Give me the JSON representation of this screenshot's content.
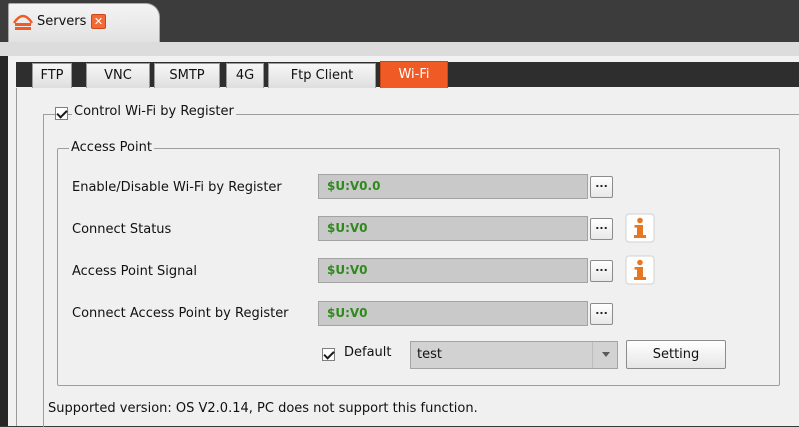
{
  "doc_tab": {
    "title": "Servers",
    "close_glyph": "✕",
    "icon": "server-icon"
  },
  "tabs": [
    {
      "label": "FTP",
      "active": false
    },
    {
      "label": "VNC",
      "active": false
    },
    {
      "label": "SMTP",
      "active": false
    },
    {
      "label": "4G",
      "active": false
    },
    {
      "label": "Ftp Client",
      "active": false
    },
    {
      "label": "Wi-Fi",
      "active": true
    }
  ],
  "wifi": {
    "control_checkbox": {
      "label": "Control Wi-Fi by Register",
      "checked": true
    },
    "access_point": {
      "title": "Access Point",
      "rows": [
        {
          "label": "Enable/Disable Wi-Fi by Register",
          "value": "$U:V0.0",
          "browse_label": "...",
          "info": false
        },
        {
          "label": "Connect Status",
          "value": "$U:V0",
          "browse_label": "...",
          "info": true
        },
        {
          "label": "Access Point Signal",
          "value": "$U:V0",
          "browse_label": "...",
          "info": true
        },
        {
          "label": "Connect Access Point by Register",
          "value": "$U:V0",
          "browse_label": "...",
          "info": false
        }
      ],
      "default_checkbox": {
        "label": "Default",
        "checked": true
      },
      "ssid_combo": {
        "value": "test"
      },
      "setting_button": "Setting"
    },
    "note": "Supported version: OS V2.0.14, PC does not support this function."
  },
  "colors": {
    "accent": "#f05a24",
    "register_text": "#2f8a1e",
    "info_icon": "#e87722"
  }
}
